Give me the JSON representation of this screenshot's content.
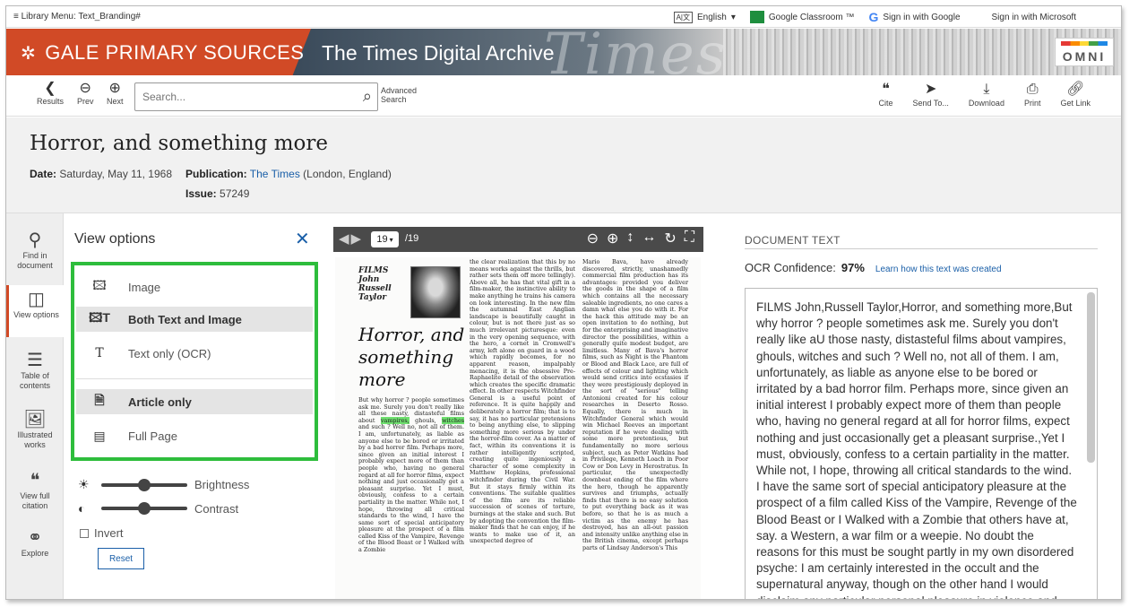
{
  "utility_bar": {
    "library_menu": "≡ Library Menu: Text_Branding#",
    "language": "English",
    "google_classroom": "Google Classroom ™",
    "sign_in_google": "Sign in with Google",
    "sign_in_microsoft": "Sign in with Microsoft"
  },
  "banner": {
    "brand": "GALE PRIMARY SOURCES",
    "archive": "The Times Digital Archive",
    "omni": "OMNI"
  },
  "toolbar": {
    "results": "Results",
    "prev": "Prev",
    "next": "Next",
    "search_placeholder": "Search...",
    "advanced_search": "Advanced Search",
    "cite": "Cite",
    "send_to": "Send To...",
    "download": "Download",
    "print": "Print",
    "get_link": "Get Link"
  },
  "document": {
    "title": "Horror, and something more",
    "date_label": "Date:",
    "date": "Saturday, May 11, 1968",
    "publication_label": "Publication:",
    "publication": "The Times",
    "publication_place": "(London, England)",
    "issue_label": "Issue:",
    "issue": "57249"
  },
  "rail": {
    "find": "Find in document",
    "view_options": "View options",
    "toc": "Table of contents",
    "illustrated": "Illustrated works",
    "citation": "View full citation",
    "explore": "Explore"
  },
  "view_options": {
    "title": "View options",
    "image": "Image",
    "both": "Both Text and Image",
    "text_only": "Text only (OCR)",
    "article_only": "Article only",
    "full_page": "Full Page",
    "brightness": "Brightness",
    "contrast": "Contrast",
    "invert": "Invert",
    "reset": "Reset",
    "brightness_level": 0.5,
    "contrast_level": 0.5
  },
  "viewer": {
    "page": "19",
    "page_count": "/19",
    "films_heading": "FILMS\nJohn\nRussell\nTaylor",
    "headline": "Horror, and something more",
    "col1": "But why horror ? people sometimes ask me. Surely you don't really like all these nasty, distasteful films about vampires, ghouls, witches and such ? Well no, not all of them. I am, unfortunately, as liable as anyone else to be bored or irritated by a bad horror film. Perhaps more, since given an initial interest I probably expect more of them than people who, having no general regard at all for horror films, expect nothing and just occasionally get a pleasant surprise. Yet I must, obviously, confess to a certain partiality in the matter. While not, I hope, throwing all critical standards to the wind, I have the same sort of special anticipatory pleasure at the prospect of a film called Kiss of the Vampire, Revenge of the Blood Beast or I Walked with a Zombie",
    "col2": "the clear realization that this by no means works against the thrills, but rather sets them off more tellingly). Above all, he has that vital gift in a film-maker, the instinctive ability to make anything he trains his camera on look interesting. In the new film the autumnal East Anglian landscape is beautifully caught in colour, but is not there just as so much irrelevant picturesque: even in the very opening sequence, with the hero, a cornet in Cromwell's army, left alone on guard in a wood which rapidly becomes, for no apparent reason, impalpably menacing, it is the obsessive Pre-Raphaelite detail of the observation which creates the specific dramatic effect. In other respects Witchfinder General is a useful point of reference. It is quite happily and deliberately a horror film; that is to say, it has no particular pretensions to being anything else, to slipping something more serious by under the horror-film cover. As a matter of fact, within its conventions it is rather intelligently scripted, creating quite ingeniously a character of some complexity in Matthew Hopkins, professional witchfinder during the Civil War. But it stays firmly within its conventions. The suitable qualities of the film are its reliable succession of scenes of torture, burnings at the stake and such. But by adopting the convention the film-maker finds that he can enjoy, if he wants to make use of it, an unexpected degree of",
    "col3": "Mario Bava, have already discovered, strictly, unashamedly commercial film production has its advantages: provided you deliver the goods in the shape of a film which contains all the necessary saleable ingredients, no one cares a damn what else you do with it. For the hack this attitude may be an open invitation to do nothing, but for the enterprising and imaginative director the possibilities, within a generally quite modest budget, are limitless. Many of Bava's horror films, such as Night is the Phantom or Blood and Black Lace, are full of effects of colour and lighting which would send critics into ecstasies if they were prestigiously deployed in the sort of \"serious\" telling Antonioni created for his colour researches in Deserto Rosso. Equally, there is much in Witchfinder General which would win Michael Reeves an important reputation if he were dealing with some more pretentious, but fundamentally no more serious subject, such as Peter Watkins had in Privilege, Kenneth Loach in Poor Cow or Don Levy in Herostratus. In particular, the unexpectedly downbeat ending of the film where the hero, though he apparently survives and triumphs, actually finds that there is no easy solution to put everything back as it was before, so that he is as much a victim as the enemy he has destroyed, has an all-out passion and intensity unlike anything else in the British cinema, except perhaps parts of Lindsay Anderson's This"
  },
  "document_text": {
    "heading": "DOCUMENT TEXT",
    "ocr_label": "OCR Confidence:",
    "ocr_value": "97%",
    "learn_link": "Learn how this text was created",
    "body": "FILMS John,Russell Taylor,Horror, and something more,But why horror ? people sometimes ask me. Surely you don't really like aU those nasty, distasteful films about vampires, ghouls, witches and such ? Well no, not all of them. I am, unfortunately, as liable as anyone else to be bored or irritated by a bad horror film. Perhaps more, since given an initial interest I probably expect more of them than people who, having no general regard at all for horror films, expect nothing and just occasionally get a pleasant surprise.,Yet I must, obviously, confess to a certain partiality in the matter. While not, I hope, throwing all critical standards to the wind. I have the same sort of special anticipatory pleasure at the prospect of a film called Kiss of the Vampire, Revenge of the Blood Beast or I Walked with a Zombie that others have at, say. a Western, a war film or a weepie. No doubt the reasons for this must be sought partly in my own disordered psyche: I am certainly interested in the occult and the supernatural anyway, though on the other hand I would disclaim any particular personal pleasure in violence and physical"
  },
  "colors": {
    "brand_red": "#d14a26",
    "highlight_green": "#2ebd3c",
    "link_blue": "#1a5fa8"
  }
}
